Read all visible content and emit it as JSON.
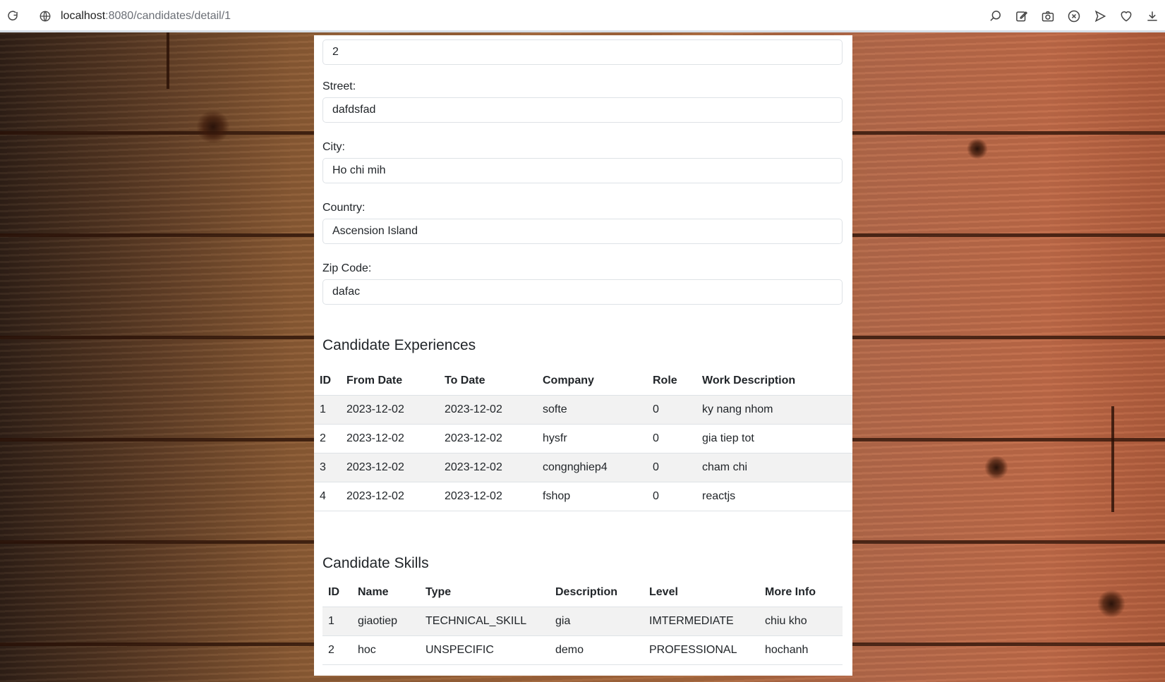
{
  "browser": {
    "url_host": "localhost",
    "url_path": ":8080/candidates/detail/1"
  },
  "address": {
    "number_value": "2",
    "street_label": "Street:",
    "street_value": "dafdsfad",
    "city_label": "City:",
    "city_value": "Ho chi mih",
    "country_label": "Country:",
    "country_value": "Ascension Island",
    "zip_label": "Zip Code:",
    "zip_value": "dafac"
  },
  "experiences": {
    "title": "Candidate Experiences",
    "headers": [
      "ID",
      "From Date",
      "To Date",
      "Company",
      "Role",
      "Work Description"
    ],
    "rows": [
      [
        "1",
        "2023-12-02",
        "2023-12-02",
        "softe",
        "0",
        "ky nang nhom"
      ],
      [
        "2",
        "2023-12-02",
        "2023-12-02",
        "hysfr",
        "0",
        "gia tiep tot"
      ],
      [
        "3",
        "2023-12-02",
        "2023-12-02",
        "congnghiep4",
        "0",
        "cham chi"
      ],
      [
        "4",
        "2023-12-02",
        "2023-12-02",
        "fshop",
        "0",
        "reactjs"
      ]
    ]
  },
  "skills": {
    "title": "Candidate Skills",
    "headers": [
      "ID",
      "Name",
      "Type",
      "Description",
      "Level",
      "More Info"
    ],
    "rows": [
      [
        "1",
        "giaotiep",
        "TECHNICAL_SKILL",
        "gia",
        "IMTERMEDIATE",
        "chiu kho"
      ],
      [
        "2",
        "hoc",
        "UNSPECIFIC",
        "demo",
        "PROFESSIONAL",
        "hochanh"
      ]
    ]
  },
  "colors": {
    "stripe": "#f2f2f2",
    "border": "#dee2e6",
    "text": "#212529"
  }
}
